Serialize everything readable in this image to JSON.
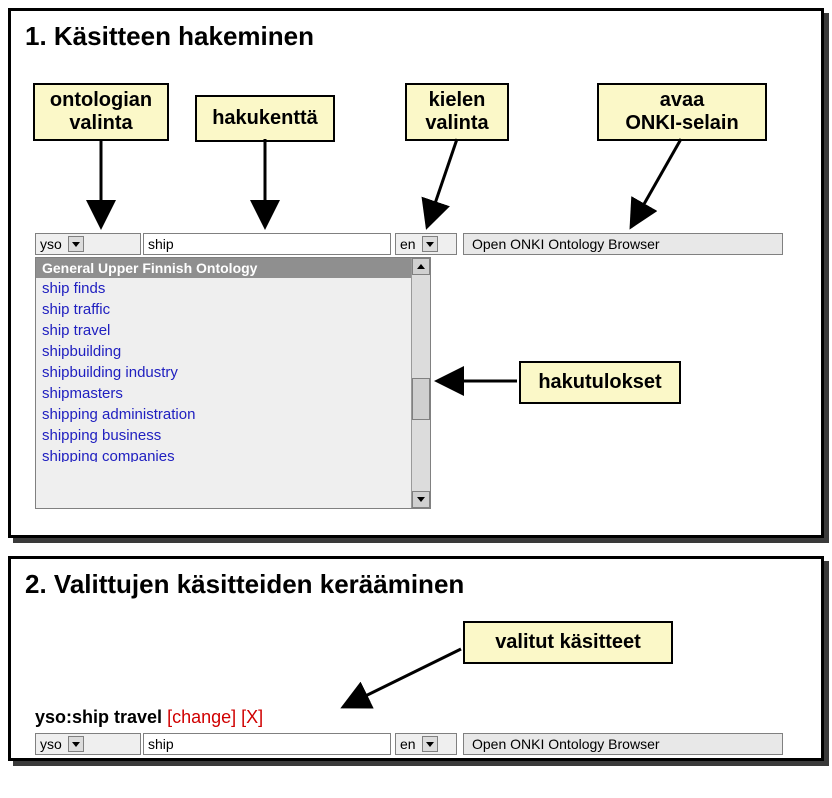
{
  "panel1": {
    "title": "1. Käsitteen hakeminen",
    "callouts": {
      "ontology": "ontologian\nvalinta",
      "searchField": "hakukenttä",
      "language": "kielen\nvalinta",
      "openBrowser": "avaa\nONKI-selain",
      "results": "hakutulokset"
    },
    "widgets": {
      "ontologyValue": "yso",
      "searchValue": "ship",
      "languageValue": "en",
      "openButton": "Open ONKI Ontology Browser"
    },
    "results": {
      "header": "General Upper Finnish Ontology",
      "items": [
        "ship finds",
        "ship traffic",
        "ship travel",
        "shipbuilding",
        "shipbuilding industry",
        "shipmasters",
        "shipping administration",
        "shipping business",
        "shipping companies"
      ]
    }
  },
  "panel2": {
    "title": "2. Valittujen käsitteiden keräämine n",
    "title_real": "2. Valittujen käsitteiden kerääminen",
    "callout": "valitut käsitteet",
    "selected": {
      "label": "yso:ship travel",
      "change": "[change]",
      "remove": "[X]"
    },
    "widgets": {
      "ontologyValue": "yso",
      "searchValue": "ship",
      "languageValue": "en",
      "openButton": "Open ONKI Ontology Browser"
    }
  }
}
